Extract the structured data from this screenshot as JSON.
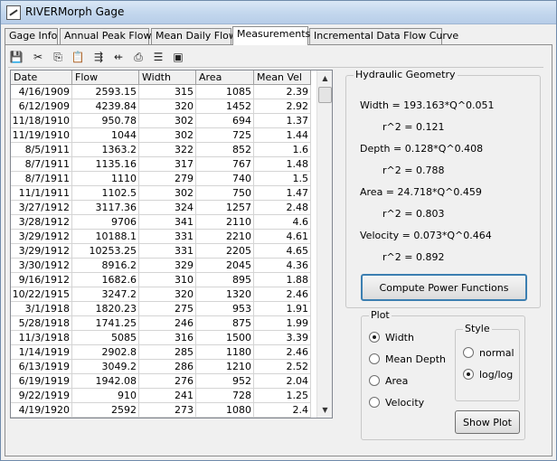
{
  "window": {
    "title": "RIVERMorph Gage"
  },
  "tabs": [
    {
      "label": "Gage Info"
    },
    {
      "label": "Annual Peak Flow"
    },
    {
      "label": "Mean Daily Flow"
    },
    {
      "label": "Measurements"
    },
    {
      "label": "Incremental Data Flow Curve"
    }
  ],
  "active_tab": "Measurements",
  "toolbar": [
    {
      "name": "save-icon",
      "glyph": "💾"
    },
    {
      "name": "cut-icon",
      "glyph": "✂"
    },
    {
      "name": "copy-icon",
      "glyph": "⎘"
    },
    {
      "name": "paste-icon",
      "glyph": "📋"
    },
    {
      "name": "insert-row-icon",
      "glyph": "⇶"
    },
    {
      "name": "delete-row-icon",
      "glyph": "⇷"
    },
    {
      "name": "print-icon",
      "glyph": "⎙"
    },
    {
      "name": "list-icon",
      "glyph": "☰"
    },
    {
      "name": "image-icon",
      "glyph": "▣"
    }
  ],
  "grid": {
    "headers": [
      "Date",
      "Flow",
      "Width",
      "Area",
      "Mean Vel"
    ],
    "rows": [
      [
        "4/16/1909",
        "2593.15",
        "315",
        "1085",
        "2.39"
      ],
      [
        "6/12/1909",
        "4239.84",
        "320",
        "1452",
        "2.92"
      ],
      [
        "11/18/1910",
        "950.78",
        "302",
        "694",
        "1.37"
      ],
      [
        "11/19/1910",
        "1044",
        "302",
        "725",
        "1.44"
      ],
      [
        "8/5/1911",
        "1363.2",
        "322",
        "852",
        "1.6"
      ],
      [
        "8/7/1911",
        "1135.16",
        "317",
        "767",
        "1.48"
      ],
      [
        "8/7/1911",
        "1110",
        "279",
        "740",
        "1.5"
      ],
      [
        "11/1/1911",
        "1102.5",
        "302",
        "750",
        "1.47"
      ],
      [
        "3/27/1912",
        "3117.36",
        "324",
        "1257",
        "2.48"
      ],
      [
        "3/28/1912",
        "9706",
        "341",
        "2110",
        "4.6"
      ],
      [
        "3/29/1912",
        "10188.1",
        "331",
        "2210",
        "4.61"
      ],
      [
        "3/29/1912",
        "10253.25",
        "331",
        "2205",
        "4.65"
      ],
      [
        "3/30/1912",
        "8916.2",
        "329",
        "2045",
        "4.36"
      ],
      [
        "9/16/1912",
        "1682.6",
        "310",
        "895",
        "1.88"
      ],
      [
        "10/22/1915",
        "3247.2",
        "320",
        "1320",
        "2.46"
      ],
      [
        "3/1/1918",
        "1820.23",
        "275",
        "953",
        "1.91"
      ],
      [
        "5/28/1918",
        "1741.25",
        "246",
        "875",
        "1.99"
      ],
      [
        "11/3/1918",
        "5085",
        "316",
        "1500",
        "3.39"
      ],
      [
        "1/14/1919",
        "2902.8",
        "285",
        "1180",
        "2.46"
      ],
      [
        "6/13/1919",
        "3049.2",
        "286",
        "1210",
        "2.52"
      ],
      [
        "6/19/1919",
        "1942.08",
        "276",
        "952",
        "2.04"
      ],
      [
        "9/22/1919",
        "910",
        "241",
        "728",
        "1.25"
      ],
      [
        "4/19/1920",
        "2592",
        "273",
        "1080",
        "2.4"
      ]
    ]
  },
  "hydraulic": {
    "title": "Hydraulic Geometry",
    "width_eq": "Width = 193.163*Q^0.051",
    "width_r2": "r^2 = 0.121",
    "depth_eq": "Depth = 0.128*Q^0.408",
    "depth_r2": "r^2 = 0.788",
    "area_eq": "Area = 24.718*Q^0.459",
    "area_r2": "r^2 = 0.803",
    "velocity_eq": "Velocity = 0.073*Q^0.464",
    "velocity_r2": "r^2 = 0.892",
    "compute_button": "Compute Power Functions"
  },
  "plot": {
    "title": "Plot",
    "options": [
      {
        "label": "Width",
        "checked": true
      },
      {
        "label": "Mean Depth",
        "checked": false
      },
      {
        "label": "Area",
        "checked": false
      },
      {
        "label": "Velocity",
        "checked": false
      }
    ],
    "style": {
      "title": "Style",
      "options": [
        {
          "label": "normal",
          "checked": false
        },
        {
          "label": "log/log",
          "checked": true
        }
      ]
    },
    "show_button": "Show Plot"
  }
}
